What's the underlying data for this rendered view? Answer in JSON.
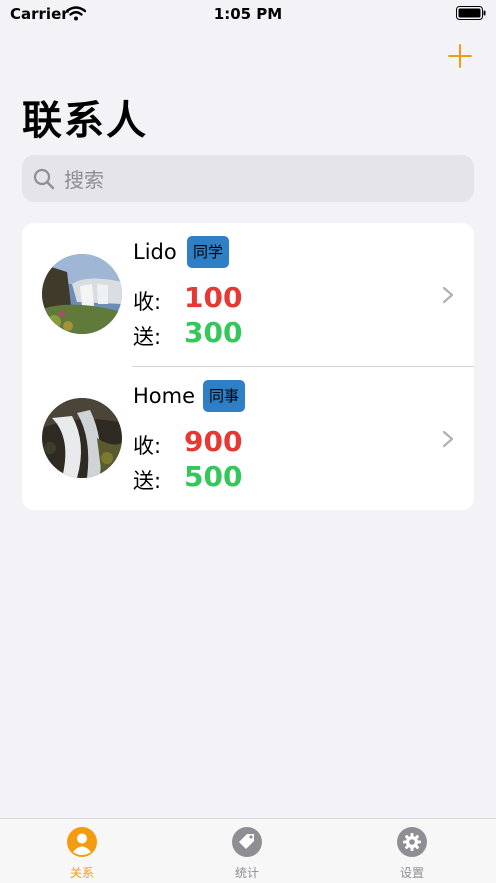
{
  "status_bar": {
    "carrier": "Carrier",
    "time": "1:05 PM"
  },
  "header": {
    "title": "联系人",
    "add_icon": "plus-icon"
  },
  "search": {
    "placeholder": "搜索"
  },
  "colors": {
    "accent": "#f39c12",
    "received": "#e53935",
    "given": "#34c759",
    "tag": "#2e7fc6"
  },
  "contacts": [
    {
      "name": "Lido",
      "tag": "同学",
      "received_label": "收:",
      "received": "100",
      "given_label": "送:",
      "given": "300"
    },
    {
      "name": "Home",
      "tag": "同事",
      "received_label": "收:",
      "received": "900",
      "given_label": "送:",
      "given": "500"
    }
  ],
  "tabs": [
    {
      "label": "关系",
      "icon": "person-icon",
      "active": true
    },
    {
      "label": "统计",
      "icon": "tag-icon",
      "active": false
    },
    {
      "label": "设置",
      "icon": "gear-icon",
      "active": false
    }
  ]
}
